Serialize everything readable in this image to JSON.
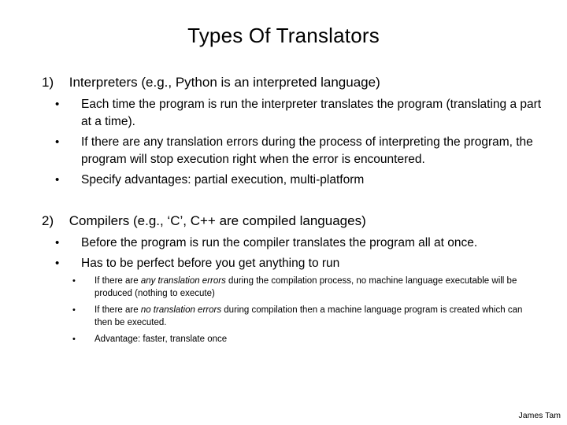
{
  "title": "Types Of Translators",
  "sections": [
    {
      "number": "1)",
      "heading": "Interpreters (e.g., Python is an interpreted language)",
      "bullets": [
        "Each time the program is run the interpreter translates the program (translating a part at a time).",
        "If there are any translation errors during the process of interpreting the program, the program will stop execution right when the error is encountered.",
        "Specify advantages: partial execution, multi-platform"
      ]
    },
    {
      "number": "2)",
      "heading": "Compilers (e.g., ‘C’, C++ are compiled languages)",
      "bullets": [
        "Before the program is run the compiler translates the program all at once.",
        "Has to be perfect before you get anything to run"
      ],
      "sub_bullets": [
        {
          "pre": "If there are ",
          "em": "any translation errors",
          "post": " during the compilation process, no machine language executable will be produced (nothing to execute)"
        },
        {
          "pre": "If there are ",
          "em": "no translation errors",
          "post": " during compilation then a machine language program is created which can then be executed."
        },
        {
          "pre": "Advantage: faster, translate once",
          "em": "",
          "post": ""
        }
      ]
    }
  ],
  "bullet_glyph": "•",
  "footer": "James Tam"
}
